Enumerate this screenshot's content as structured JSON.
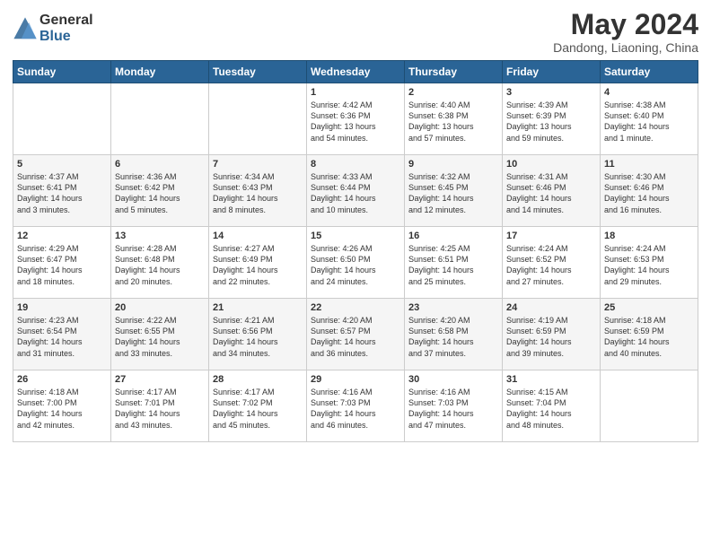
{
  "logo": {
    "general": "General",
    "blue": "Blue"
  },
  "title": "May 2024",
  "location": "Dandong, Liaoning, China",
  "weekdays": [
    "Sunday",
    "Monday",
    "Tuesday",
    "Wednesday",
    "Thursday",
    "Friday",
    "Saturday"
  ],
  "weeks": [
    [
      {
        "day": "",
        "content": ""
      },
      {
        "day": "",
        "content": ""
      },
      {
        "day": "",
        "content": ""
      },
      {
        "day": "1",
        "content": "Sunrise: 4:42 AM\nSunset: 6:36 PM\nDaylight: 13 hours\nand 54 minutes."
      },
      {
        "day": "2",
        "content": "Sunrise: 4:40 AM\nSunset: 6:38 PM\nDaylight: 13 hours\nand 57 minutes."
      },
      {
        "day": "3",
        "content": "Sunrise: 4:39 AM\nSunset: 6:39 PM\nDaylight: 13 hours\nand 59 minutes."
      },
      {
        "day": "4",
        "content": "Sunrise: 4:38 AM\nSunset: 6:40 PM\nDaylight: 14 hours\nand 1 minute."
      }
    ],
    [
      {
        "day": "5",
        "content": "Sunrise: 4:37 AM\nSunset: 6:41 PM\nDaylight: 14 hours\nand 3 minutes."
      },
      {
        "day": "6",
        "content": "Sunrise: 4:36 AM\nSunset: 6:42 PM\nDaylight: 14 hours\nand 5 minutes."
      },
      {
        "day": "7",
        "content": "Sunrise: 4:34 AM\nSunset: 6:43 PM\nDaylight: 14 hours\nand 8 minutes."
      },
      {
        "day": "8",
        "content": "Sunrise: 4:33 AM\nSunset: 6:44 PM\nDaylight: 14 hours\nand 10 minutes."
      },
      {
        "day": "9",
        "content": "Sunrise: 4:32 AM\nSunset: 6:45 PM\nDaylight: 14 hours\nand 12 minutes."
      },
      {
        "day": "10",
        "content": "Sunrise: 4:31 AM\nSunset: 6:46 PM\nDaylight: 14 hours\nand 14 minutes."
      },
      {
        "day": "11",
        "content": "Sunrise: 4:30 AM\nSunset: 6:46 PM\nDaylight: 14 hours\nand 16 minutes."
      }
    ],
    [
      {
        "day": "12",
        "content": "Sunrise: 4:29 AM\nSunset: 6:47 PM\nDaylight: 14 hours\nand 18 minutes."
      },
      {
        "day": "13",
        "content": "Sunrise: 4:28 AM\nSunset: 6:48 PM\nDaylight: 14 hours\nand 20 minutes."
      },
      {
        "day": "14",
        "content": "Sunrise: 4:27 AM\nSunset: 6:49 PM\nDaylight: 14 hours\nand 22 minutes."
      },
      {
        "day": "15",
        "content": "Sunrise: 4:26 AM\nSunset: 6:50 PM\nDaylight: 14 hours\nand 24 minutes."
      },
      {
        "day": "16",
        "content": "Sunrise: 4:25 AM\nSunset: 6:51 PM\nDaylight: 14 hours\nand 25 minutes."
      },
      {
        "day": "17",
        "content": "Sunrise: 4:24 AM\nSunset: 6:52 PM\nDaylight: 14 hours\nand 27 minutes."
      },
      {
        "day": "18",
        "content": "Sunrise: 4:24 AM\nSunset: 6:53 PM\nDaylight: 14 hours\nand 29 minutes."
      }
    ],
    [
      {
        "day": "19",
        "content": "Sunrise: 4:23 AM\nSunset: 6:54 PM\nDaylight: 14 hours\nand 31 minutes."
      },
      {
        "day": "20",
        "content": "Sunrise: 4:22 AM\nSunset: 6:55 PM\nDaylight: 14 hours\nand 33 minutes."
      },
      {
        "day": "21",
        "content": "Sunrise: 4:21 AM\nSunset: 6:56 PM\nDaylight: 14 hours\nand 34 minutes."
      },
      {
        "day": "22",
        "content": "Sunrise: 4:20 AM\nSunset: 6:57 PM\nDaylight: 14 hours\nand 36 minutes."
      },
      {
        "day": "23",
        "content": "Sunrise: 4:20 AM\nSunset: 6:58 PM\nDaylight: 14 hours\nand 37 minutes."
      },
      {
        "day": "24",
        "content": "Sunrise: 4:19 AM\nSunset: 6:59 PM\nDaylight: 14 hours\nand 39 minutes."
      },
      {
        "day": "25",
        "content": "Sunrise: 4:18 AM\nSunset: 6:59 PM\nDaylight: 14 hours\nand 40 minutes."
      }
    ],
    [
      {
        "day": "26",
        "content": "Sunrise: 4:18 AM\nSunset: 7:00 PM\nDaylight: 14 hours\nand 42 minutes."
      },
      {
        "day": "27",
        "content": "Sunrise: 4:17 AM\nSunset: 7:01 PM\nDaylight: 14 hours\nand 43 minutes."
      },
      {
        "day": "28",
        "content": "Sunrise: 4:17 AM\nSunset: 7:02 PM\nDaylight: 14 hours\nand 45 minutes."
      },
      {
        "day": "29",
        "content": "Sunrise: 4:16 AM\nSunset: 7:03 PM\nDaylight: 14 hours\nand 46 minutes."
      },
      {
        "day": "30",
        "content": "Sunrise: 4:16 AM\nSunset: 7:03 PM\nDaylight: 14 hours\nand 47 minutes."
      },
      {
        "day": "31",
        "content": "Sunrise: 4:15 AM\nSunset: 7:04 PM\nDaylight: 14 hours\nand 48 minutes."
      },
      {
        "day": "",
        "content": ""
      }
    ]
  ]
}
